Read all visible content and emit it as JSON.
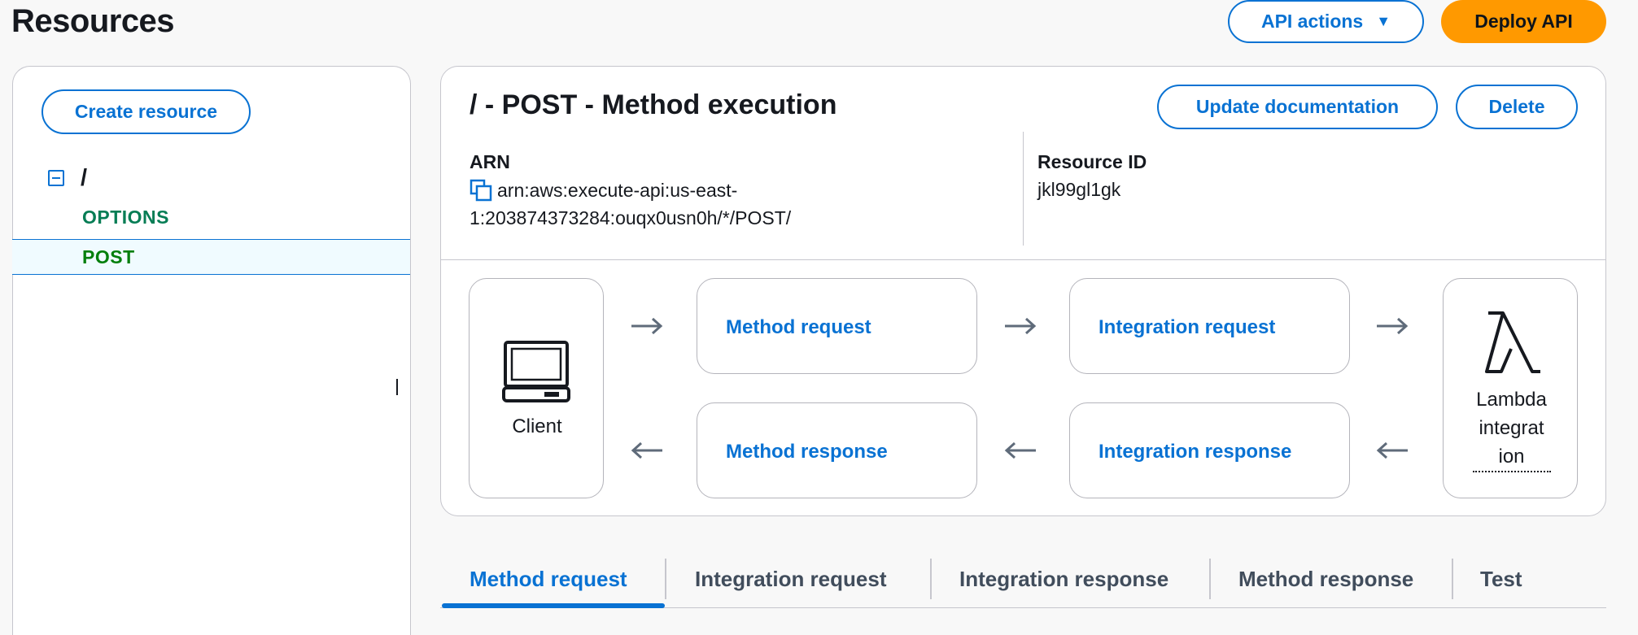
{
  "header": {
    "title": "Resources",
    "api_actions_label": "API actions",
    "deploy_label": "Deploy API"
  },
  "sidebar": {
    "create_resource_label": "Create resource",
    "root_path": "/",
    "methods": [
      {
        "label": "OPTIONS"
      },
      {
        "label": "POST",
        "selected": true
      }
    ]
  },
  "method_execution": {
    "title": "/ - POST - Method execution",
    "update_docs_label": "Update documentation",
    "delete_label": "Delete",
    "arn_label": "ARN",
    "arn_line1": "arn:aws:execute-api:us-east-",
    "arn_line2": "1:203874373284:ouqx0usn0h/*/POST/",
    "resource_id_label": "Resource ID",
    "resource_id_value": "jkl99gl1gk"
  },
  "flow": {
    "client_label": "Client",
    "method_request": "Method request",
    "integration_request": "Integration request",
    "method_response": "Method response",
    "integration_response": "Integration response",
    "lambda_line1": "Lambda",
    "lambda_line2": "integrat",
    "lambda_line3": "ion"
  },
  "tabs": [
    {
      "label": "Method request",
      "active": true
    },
    {
      "label": "Integration request"
    },
    {
      "label": "Integration response"
    },
    {
      "label": "Method response"
    },
    {
      "label": "Test"
    }
  ],
  "colors": {
    "accent": "#0972d3",
    "primary_button": "#ff9900",
    "method_green": "#037f0c"
  }
}
